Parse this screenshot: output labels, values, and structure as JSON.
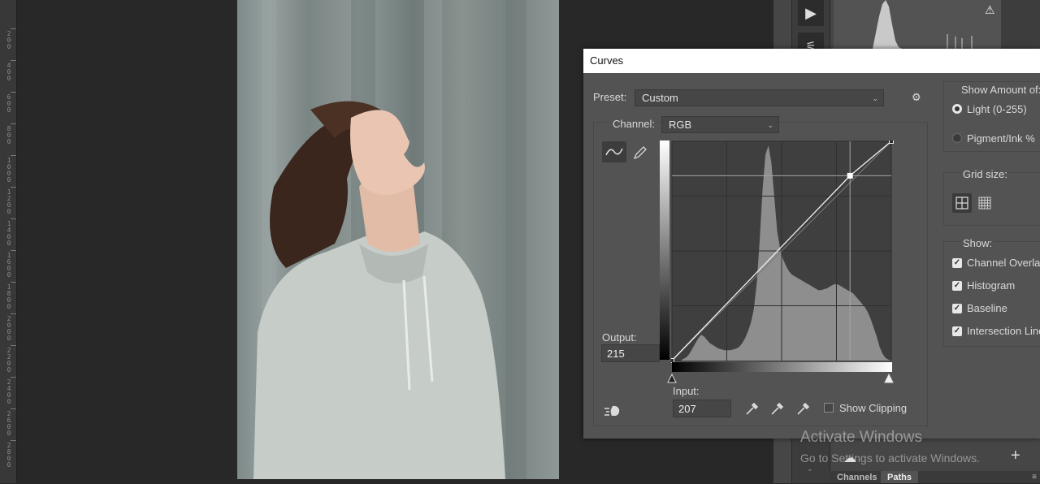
{
  "ruler": {
    "labels": [
      "200",
      "400",
      "600",
      "800",
      "1000",
      "1200",
      "1400",
      "1600",
      "1800",
      "2000",
      "2200",
      "2400",
      "2600",
      "2800"
    ]
  },
  "curves_dialog": {
    "title": "Curves",
    "preset": {
      "label": "Preset:",
      "value": "Custom"
    },
    "channel": {
      "label": "Channel:",
      "value": "RGB"
    },
    "output": {
      "label": "Output:",
      "value": "215"
    },
    "input": {
      "label": "Input:",
      "value": "207"
    },
    "show_clipping": {
      "label": "Show Clipping",
      "checked": false
    },
    "show_amount_of": {
      "title": "Show Amount of:",
      "options": [
        {
          "label": "Light  (0-255)",
          "selected": true
        },
        {
          "label": "Pigment/Ink %",
          "selected": false
        }
      ]
    },
    "grid_size": {
      "title": "Grid size:",
      "selected": "simple"
    },
    "show": {
      "title": "Show:",
      "items": [
        {
          "label": "Channel Overlays",
          "checked": true
        },
        {
          "label": "Histogram",
          "checked": true
        },
        {
          "label": "Baseline",
          "checked": true
        },
        {
          "label": "Intersection Line",
          "checked": true
        }
      ]
    },
    "curve_points": [
      {
        "input": 0,
        "output": 0
      },
      {
        "input": 207,
        "output": 215
      },
      {
        "input": 255,
        "output": 255
      }
    ],
    "histogram_profile": [
      0,
      0,
      0,
      0,
      2,
      4,
      8,
      14,
      20,
      26,
      30,
      28,
      24,
      20,
      18,
      16,
      14,
      13,
      12,
      12,
      12,
      13,
      14,
      16,
      20,
      26,
      34,
      44,
      60,
      90,
      140,
      200,
      240,
      250,
      230,
      190,
      150,
      130,
      118,
      110,
      104,
      100,
      98,
      96,
      94,
      92,
      90,
      88,
      86,
      84,
      82,
      82,
      83,
      84,
      86,
      88,
      89,
      88,
      86,
      84,
      82,
      80,
      78,
      74,
      70,
      66,
      62,
      56,
      48,
      38,
      28,
      16,
      8,
      3,
      1,
      0
    ]
  },
  "watermark": {
    "line1": "Activate Windows",
    "line2": "Go to Settings to activate Windows."
  },
  "panels": {
    "tabs": [
      "Channels",
      "Paths"
    ],
    "active_tab": "Paths"
  }
}
